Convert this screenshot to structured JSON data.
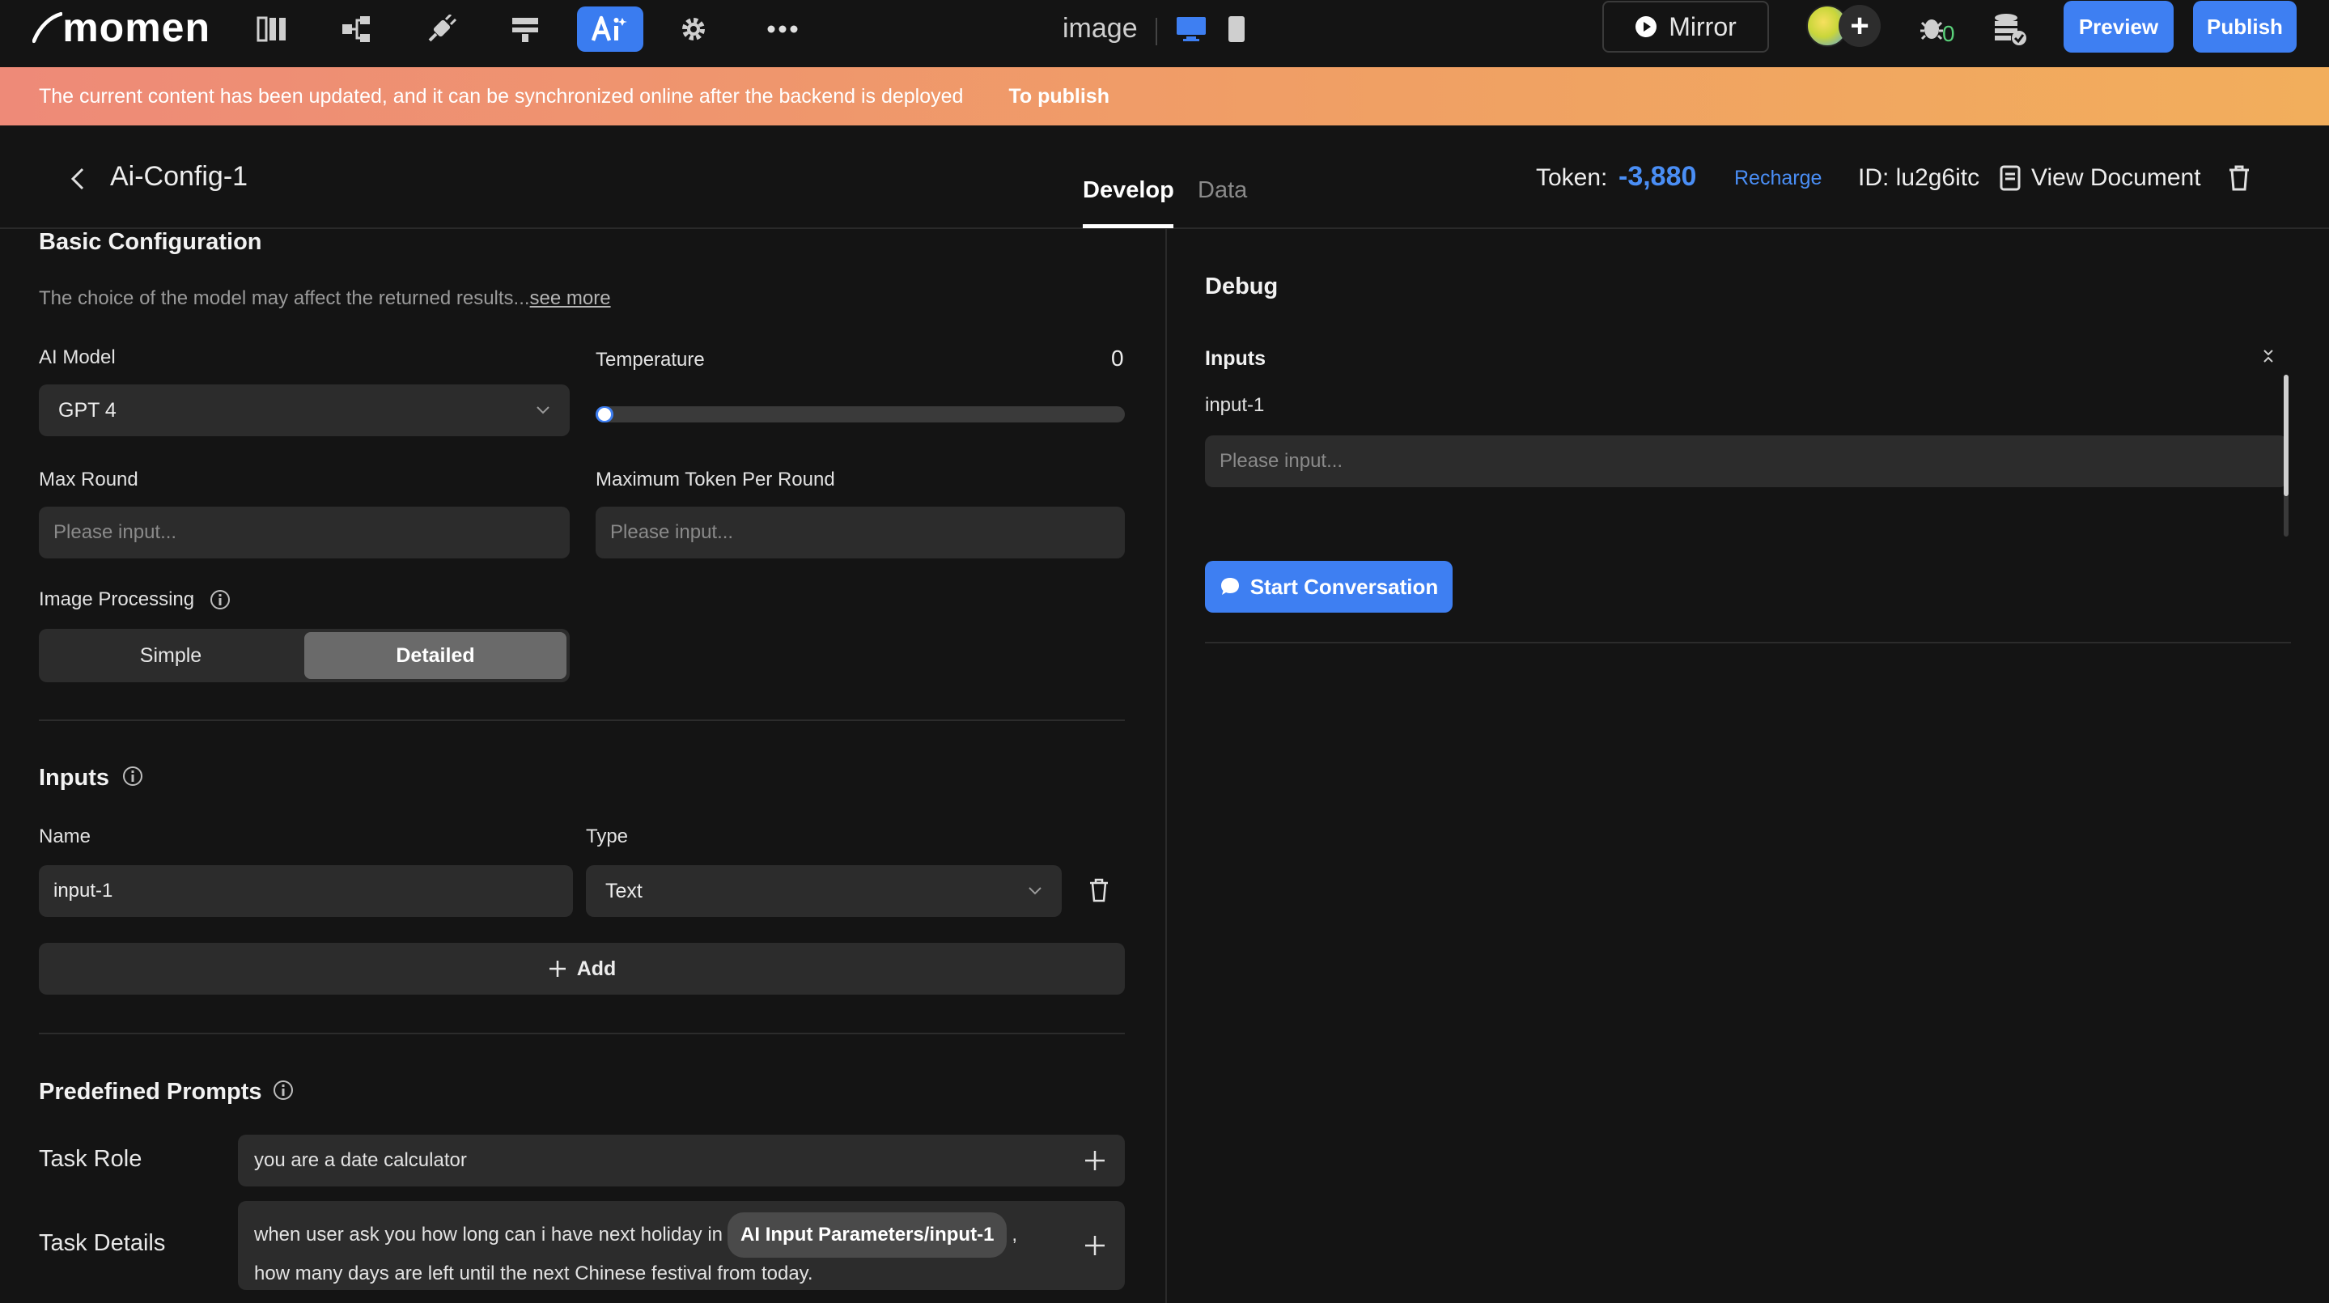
{
  "topbar": {
    "logo_text": "momen",
    "mode_label": "image",
    "mirror_label": "Mirror",
    "bug_count": "0",
    "preview_label": "Preview",
    "publish_label": "Publish",
    "tools": [
      "page-tree-icon",
      "component-tree-icon",
      "plugin-icon",
      "data-model-icon",
      "ai-icon",
      "settings-icon",
      "more-icon"
    ],
    "active_tool": "ai-icon"
  },
  "banner": {
    "message": "The current content has been updated, and it can be synchronized online after the backend is deployed",
    "link_label": "To publish"
  },
  "header": {
    "title": "Ai-Config-1",
    "tabs": [
      "Develop",
      "Data"
    ],
    "active_tab": "Develop",
    "token_label": "Token:",
    "token_value": "-3,880",
    "recharge_label": "Recharge",
    "id_label": "ID: lu2g6itc",
    "view_document_label": "View Document"
  },
  "basic": {
    "title": "Basic Configuration",
    "hint": "The choice of the model may affect the returned results...",
    "hint_link": "see more",
    "ai_model_label": "AI Model",
    "ai_model_value": "GPT 4",
    "temperature_label": "Temperature",
    "temperature_value": "0",
    "temperature_level": 0.0,
    "max_round_label": "Max Round",
    "max_round_placeholder": "Please input...",
    "max_token_label": "Maximum Token Per Round",
    "max_token_placeholder": "Please input...",
    "image_processing_label": "Image Processing",
    "image_processing_options": [
      "Simple",
      "Detailed"
    ],
    "image_processing_selected": "Detailed"
  },
  "inputs": {
    "title": "Inputs",
    "name_header": "Name",
    "type_header": "Type",
    "rows": [
      {
        "name": "input-1",
        "type": "Text"
      }
    ],
    "add_label": "Add"
  },
  "prompts": {
    "title": "Predefined Prompts",
    "task_role_label": "Task Role",
    "task_role_value": "you are a date calculator",
    "task_details_label": "Task Details",
    "task_details_part1": "when user ask you how long can i have next holiday in",
    "task_details_chip": "AI Input Parameters/input-1",
    "task_details_part2": ",",
    "task_details_part3": "how many days are left until the next Chinese festival from today."
  },
  "debug": {
    "title": "Debug",
    "inputs_label": "Inputs",
    "input_name": "input-1",
    "input_placeholder": "Please input...",
    "start_label": "Start Conversation"
  },
  "colors": {
    "accent": "#3e7ff2",
    "token_value": "#4a8ef5",
    "banner_start": "#ee8a78",
    "banner_end": "#f2ae5c",
    "background": "#141414",
    "field": "#2c2c2c"
  }
}
